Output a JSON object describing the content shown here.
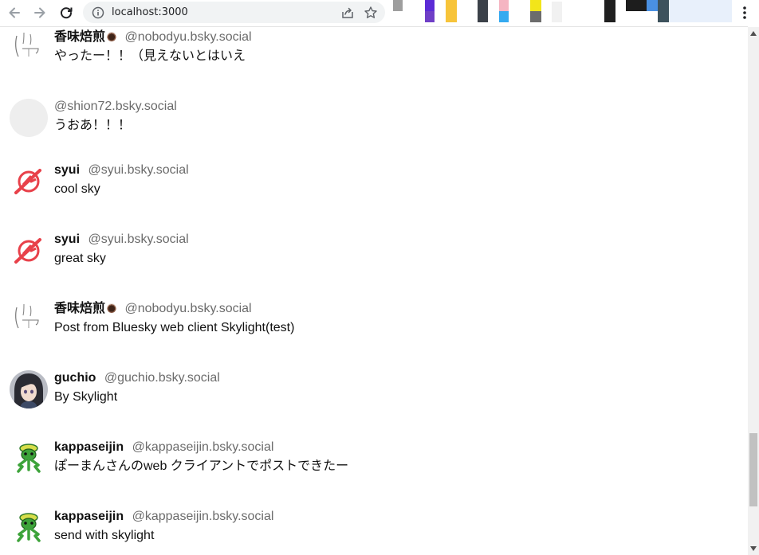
{
  "browser": {
    "url": "localhost:3000",
    "icons": {
      "back": "back-arrow-icon",
      "forward": "forward-arrow-icon",
      "reload": "reload-icon",
      "site_info": "info-circle-icon",
      "share": "share-icon",
      "bookmark": "star-icon",
      "menu": "kebab-menu-icon"
    }
  },
  "feed": {
    "posts": [
      {
        "display_name": "香味焙煎",
        "has_coffee_emoji": true,
        "handle": "@nobodyu.bsky.social",
        "text": "やったー！！（見えないとはいえ",
        "avatar": "sketch"
      },
      {
        "display_name": "",
        "handle": "@shion72.bsky.social",
        "text": "うおあ！！！",
        "avatar": "blank"
      },
      {
        "display_name": "syui",
        "handle": "@syui.bsky.social",
        "text": "cool sky",
        "avatar": "syui"
      },
      {
        "display_name": "syui",
        "handle": "@syui.bsky.social",
        "text": "great sky",
        "avatar": "syui"
      },
      {
        "display_name": "香味焙煎",
        "has_coffee_emoji": true,
        "handle": "@nobodyu.bsky.social",
        "text": "Post from Bluesky web client Skylight(test)",
        "avatar": "sketch"
      },
      {
        "display_name": "guchio",
        "handle": "@guchio.bsky.social",
        "text": "By Skylight",
        "avatar": "photo"
      },
      {
        "display_name": "kappaseijin",
        "handle": "@kappaseijin.bsky.social",
        "text": "ぽーまんさんのweb クライアントでポストできたー",
        "avatar": "kappa"
      },
      {
        "display_name": "kappaseijin",
        "handle": "@kappaseijin.bsky.social",
        "text": "send with skylight",
        "avatar": "kappa"
      }
    ]
  },
  "colors": {
    "handle": "#6b6b6b",
    "syui_red": "#e8414a",
    "kappa_green": "#3da33a",
    "scroll_thumb": "#c1c1c1"
  }
}
